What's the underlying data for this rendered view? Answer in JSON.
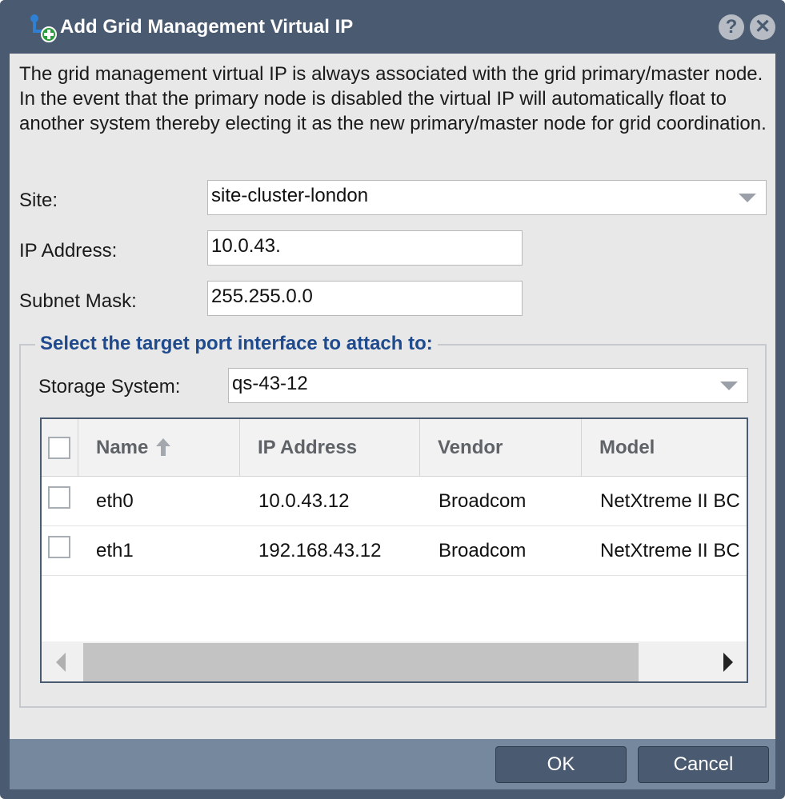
{
  "window": {
    "title": "Add Grid Management Virtual IP",
    "help_symbol": "?",
    "close_symbol": "✕",
    "app_icon": "network-add-icon"
  },
  "description": "The grid management virtual IP is always associated with the grid primary/master node. In the event that the primary node is disabled the virtual IP will automatically float to another system thereby electing it as the new primary/master node for grid coordination.",
  "form": {
    "site_label": "Site:",
    "site_value": "site-cluster-london",
    "ip_label": "IP Address:",
    "ip_value": "10.0.43.",
    "subnet_label": "Subnet Mask:",
    "subnet_value": "255.255.0.0"
  },
  "port_section": {
    "legend": "Select the target port interface to attach to:",
    "storage_label": "Storage System:",
    "storage_value": "qs-43-12",
    "columns": [
      "Name",
      "IP Address",
      "Vendor",
      "Model"
    ],
    "sort_column": "Name",
    "sort_direction": "ascending",
    "rows": [
      {
        "name": "eth0",
        "ip": "10.0.43.12",
        "vendor": "Broadcom",
        "model": "NetXtreme II BC"
      },
      {
        "name": "eth1",
        "ip": "192.168.43.12",
        "vendor": "Broadcom",
        "model": "NetXtreme II BC"
      }
    ]
  },
  "buttons": {
    "ok": "OK",
    "cancel": "Cancel"
  },
  "colors": {
    "titlebar": "#4a5a70",
    "body": "#e8e8e8",
    "footer": "#76889e",
    "legend_text": "#1f4b8e"
  }
}
